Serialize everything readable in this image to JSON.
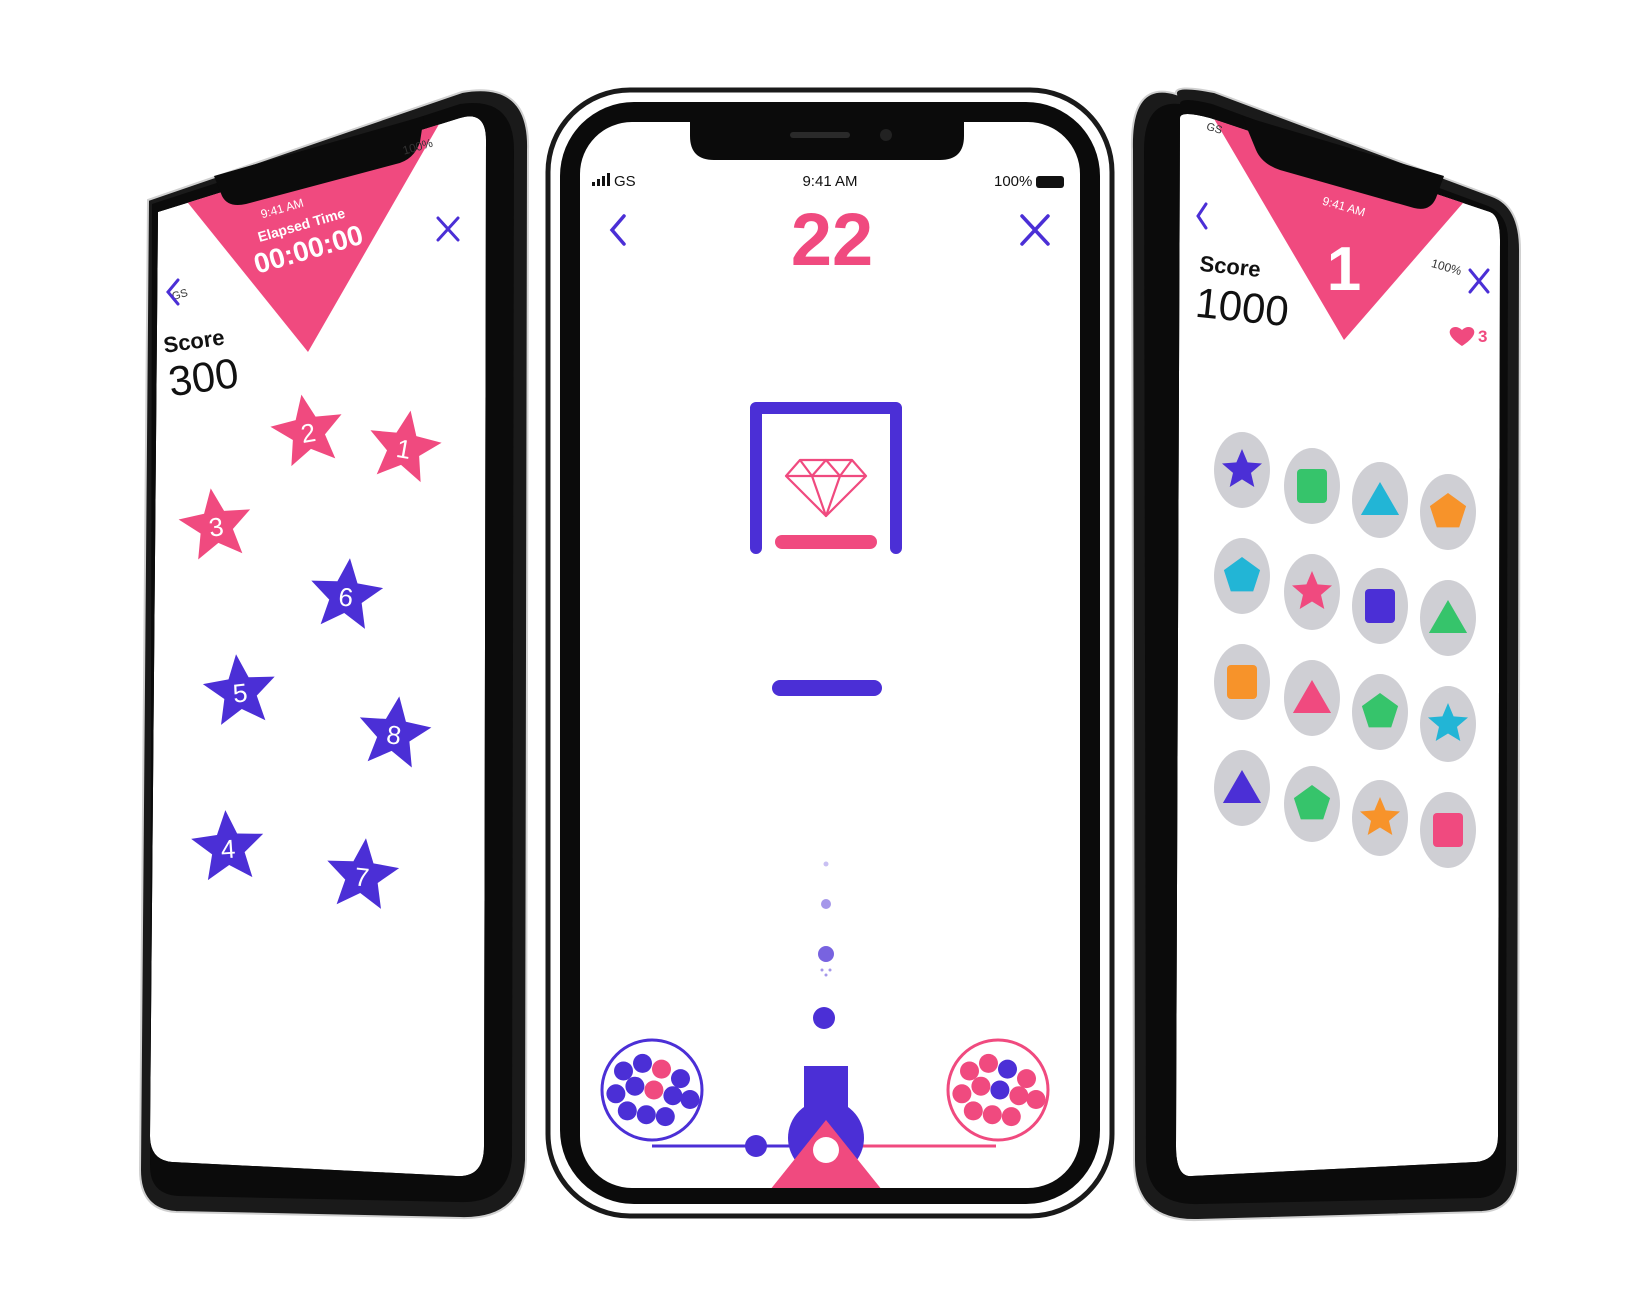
{
  "colors": {
    "pink": "#f04a7f",
    "purple": "#4b2fd6",
    "teal": "#22b5d6",
    "green": "#36c46b",
    "orange": "#f7932a",
    "gray_disc": "#cfcfd4"
  },
  "left_phone": {
    "status": {
      "carrier": "GS",
      "time": "9:41 AM",
      "battery": "100%"
    },
    "timer": {
      "label": "Elapsed Time",
      "value": "00:00:00"
    },
    "score": {
      "label": "Score",
      "value": "300"
    },
    "nav": {
      "back_icon": "chevron-left-icon",
      "close_icon": "close-icon"
    },
    "stars": [
      {
        "number": "2",
        "color": "pink"
      },
      {
        "number": "1",
        "color": "pink"
      },
      {
        "number": "3",
        "color": "pink"
      },
      {
        "number": "6",
        "color": "purple"
      },
      {
        "number": "5",
        "color": "purple"
      },
      {
        "number": "8",
        "color": "purple"
      },
      {
        "number": "4",
        "color": "purple"
      },
      {
        "number": "7",
        "color": "purple"
      }
    ]
  },
  "middle_phone": {
    "status": {
      "carrier": "GS",
      "time": "9:41 AM",
      "battery": "100%"
    },
    "counter": "22",
    "nav": {
      "back_icon": "chevron-left-icon",
      "close_icon": "close-icon"
    },
    "target_icon": "diamond-icon",
    "left_ball_container": {
      "purple_balls": 10,
      "pink_balls": 2
    },
    "right_ball_container": {
      "pink_balls": 10,
      "purple_balls": 2
    }
  },
  "right_phone": {
    "status": {
      "carrier": "GS",
      "time": "9:41 AM",
      "battery": "100%"
    },
    "level": "1",
    "score": {
      "label": "Score",
      "value": "1000"
    },
    "lives": "3",
    "nav": {
      "back_icon": "chevron-left-icon",
      "close_icon": "close-icon"
    },
    "shapes": [
      [
        "star purple",
        "square green",
        "triangle teal",
        "pentagon orange"
      ],
      [
        "pentagon teal",
        "star pink",
        "square purple",
        "triangle green"
      ],
      [
        "square orange",
        "triangle pink",
        "pentagon green",
        "star teal"
      ],
      [
        "triangle purple",
        "pentagon green",
        "star orange",
        "square pink"
      ]
    ]
  }
}
